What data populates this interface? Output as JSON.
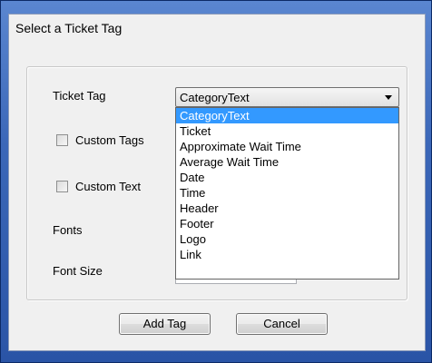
{
  "dialog": {
    "title": "Select a Ticket Tag"
  },
  "form": {
    "ticket_tag_label": "Ticket Tag",
    "custom_tags_label": "Custom Tags",
    "custom_text_label": "Custom Text",
    "fonts_label": "Fonts",
    "font_size_label": "Font Size",
    "ticket_tag_value": "CategoryText",
    "custom_tags_checked": false,
    "custom_text_checked": false
  },
  "dropdown": {
    "options": [
      "CategoryText",
      "Ticket",
      "Approximate Wait Time",
      "Average Wait Time",
      "Date",
      "Time",
      "Header",
      "Footer",
      "Logo",
      "Link"
    ],
    "selected_index": 0,
    "highlight_color": "#3399ff"
  },
  "buttons": {
    "add_tag_label": "Add Tag",
    "cancel_label": "Cancel"
  }
}
